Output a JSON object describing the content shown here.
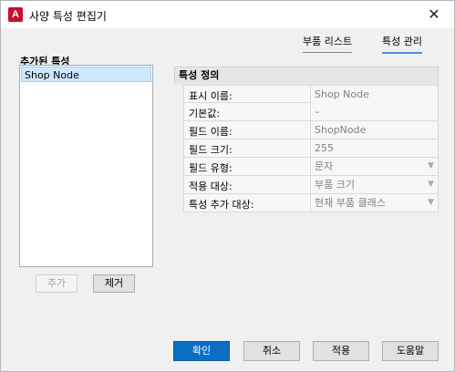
{
  "window": {
    "title": "사양 특성 편집기",
    "close_glyph": "✕"
  },
  "tabs": [
    {
      "label": "부품 리스트",
      "active": false
    },
    {
      "label": "특성 관리",
      "active": true
    }
  ],
  "left_panel": {
    "label": "추가된 특성",
    "items": [
      {
        "label": "Shop Node",
        "selected": true
      }
    ],
    "add_label": "추가",
    "remove_label": "제거"
  },
  "definition": {
    "header": "특성 정의",
    "rows": [
      {
        "label": "표시 이름:",
        "value": "Shop Node",
        "dropdown": false
      },
      {
        "label": "기본값:",
        "value": "–",
        "dropdown": false
      },
      {
        "label": "필드 이름:",
        "value": "ShopNode",
        "dropdown": false
      },
      {
        "label": "필드 크기:",
        "value": "255",
        "dropdown": false
      },
      {
        "label": "필드 유형:",
        "value": "문자",
        "dropdown": true
      },
      {
        "label": "적용 대상:",
        "value": "부품 크기",
        "dropdown": true
      },
      {
        "label": "특성 추가 대상:",
        "value": "현재 부품 클래스",
        "dropdown": true
      }
    ]
  },
  "footer": {
    "ok_label": "확인",
    "cancel_label": "취소",
    "apply_label": "적용",
    "help_label": "도움말"
  },
  "colors": {
    "accent": "#0a6ec4",
    "tab_underline": "#4a90d9",
    "selection": "#cde8ff"
  },
  "icons": {
    "app": "autocad-a-icon",
    "dropdown": "chevron-down-icon"
  }
}
